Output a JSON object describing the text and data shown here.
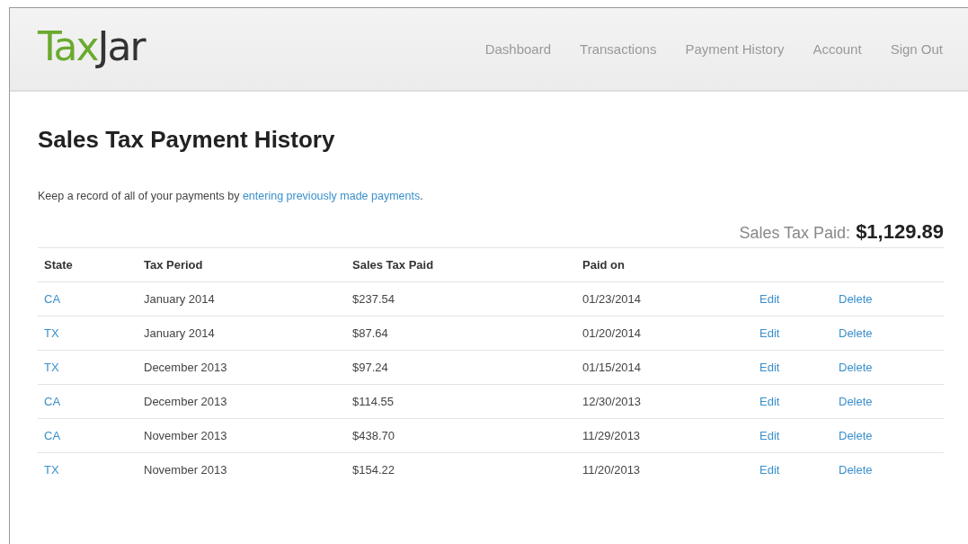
{
  "logo": {
    "part_1": "Tax",
    "part_2": "Jar"
  },
  "nav": [
    "Dashboard",
    "Transactions",
    "Payment History",
    "Account",
    "Sign Out"
  ],
  "page_title": "Sales Tax Payment History",
  "intro": {
    "text": "Keep a record of all of your payments by ",
    "link": "entering previously made payments",
    "end": "."
  },
  "total": {
    "label": "Sales Tax Paid:",
    "value": "$1,129.89"
  },
  "table": {
    "columns": [
      "State",
      "Tax Period",
      "Sales Tax Paid",
      "Paid on"
    ],
    "rows": [
      {
        "state": "CA",
        "period": "January 2014",
        "amount": "$237.54",
        "paid_on": "01/23/2014",
        "edit": "Edit",
        "delete": "Delete"
      },
      {
        "state": "TX",
        "period": "January 2014",
        "amount": "$87.64",
        "paid_on": "01/20/2014",
        "edit": "Edit",
        "delete": "Delete"
      },
      {
        "state": "TX",
        "period": "December 2013",
        "amount": "$97.24",
        "paid_on": "01/15/2014",
        "edit": "Edit",
        "delete": "Delete"
      },
      {
        "state": "CA",
        "period": "December 2013",
        "amount": "$114.55",
        "paid_on": "12/30/2013",
        "edit": "Edit",
        "delete": "Delete"
      },
      {
        "state": "CA",
        "period": "November 2013",
        "amount": "$438.70",
        "paid_on": "11/29/2013",
        "edit": "Edit",
        "delete": "Delete"
      },
      {
        "state": "TX",
        "period": "November 2013",
        "amount": "$154.22",
        "paid_on": "11/20/2013",
        "edit": "Edit",
        "delete": "Delete"
      }
    ]
  }
}
